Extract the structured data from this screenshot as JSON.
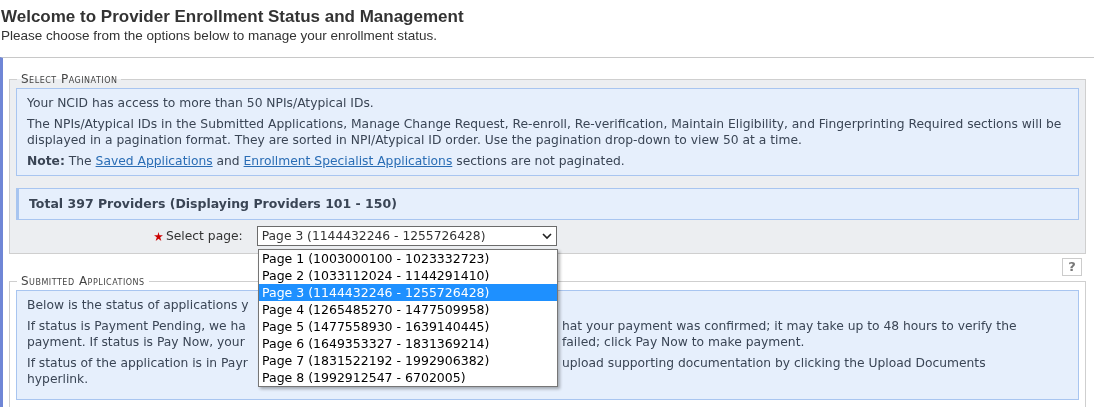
{
  "header": {
    "title": "Welcome to Provider Enrollment Status and Management",
    "subtitle": "Please choose from the options below to manage your enrollment status."
  },
  "pagination": {
    "legend": "Select Pagination",
    "info": [
      "Your NCID has access to more than 50 NPIs/Atypical IDs.",
      "The NPIs/Atypical IDs in the Submitted Applications, Manage Change Request, Re-enroll, Re-verification, Maintain Eligibility, and Fingerprinting Required sections will be displayed in a pagination format. They are sorted in NPI/Atypical ID order. Use the pagination drop-down to view 50 at a time."
    ],
    "note": [
      {
        "kind": "text",
        "text": "**Note:** The "
      },
      {
        "kind": "link",
        "text": "Saved Applications"
      },
      {
        "kind": "text",
        "text": " and "
      },
      {
        "kind": "link",
        "text": "Enrollment Specialist Applications"
      },
      {
        "kind": "text",
        "text": " sections are not paginated."
      }
    ],
    "total": "Total 397 Providers (Displaying Providers 101 - 150)",
    "select": {
      "label": "Select page:",
      "required": true,
      "value": "Page 3 (1144432246 - 1255726428)",
      "expanded": true,
      "options": [
        {
          "label": "Page 1 (1003000100 - 1023332723)",
          "selected": false
        },
        {
          "label": "Page 2 (1033112024 - 1144291410)",
          "selected": false
        },
        {
          "label": "Page 3 (1144432246 - 1255726428)",
          "selected": true
        },
        {
          "label": "Page 4 (1265485270 - 1477509958)",
          "selected": false
        },
        {
          "label": "Page 5 (1477558930 - 1639140445)",
          "selected": false
        },
        {
          "label": "Page 6 (1649353327 - 1831369214)",
          "selected": false
        },
        {
          "label": "Page 7 (1831522192 - 1992906382)",
          "selected": false
        },
        {
          "label": "Page 8 (1992912547 - 6702005)",
          "selected": false
        }
      ]
    }
  },
  "submitted": {
    "legend": "Submitted Applications",
    "help": "?",
    "paragraphs": [
      {
        "left": [
          "Below is the status of applications y"
        ]
      },
      {
        "left": [
          "If status is Payment Pending, we ha",
          "payment. If status is Pay Now, your"
        ],
        "right": [
          "hat your payment was confirmed; it may take up to 48 hours to verify the",
          "failed; click Pay Now to make payment."
        ]
      },
      {
        "left": [
          "If status of the application is in Payr",
          "hyperlink."
        ],
        "right": [
          "upload supporting documentation by clicking the Upload Documents"
        ]
      }
    ]
  }
}
